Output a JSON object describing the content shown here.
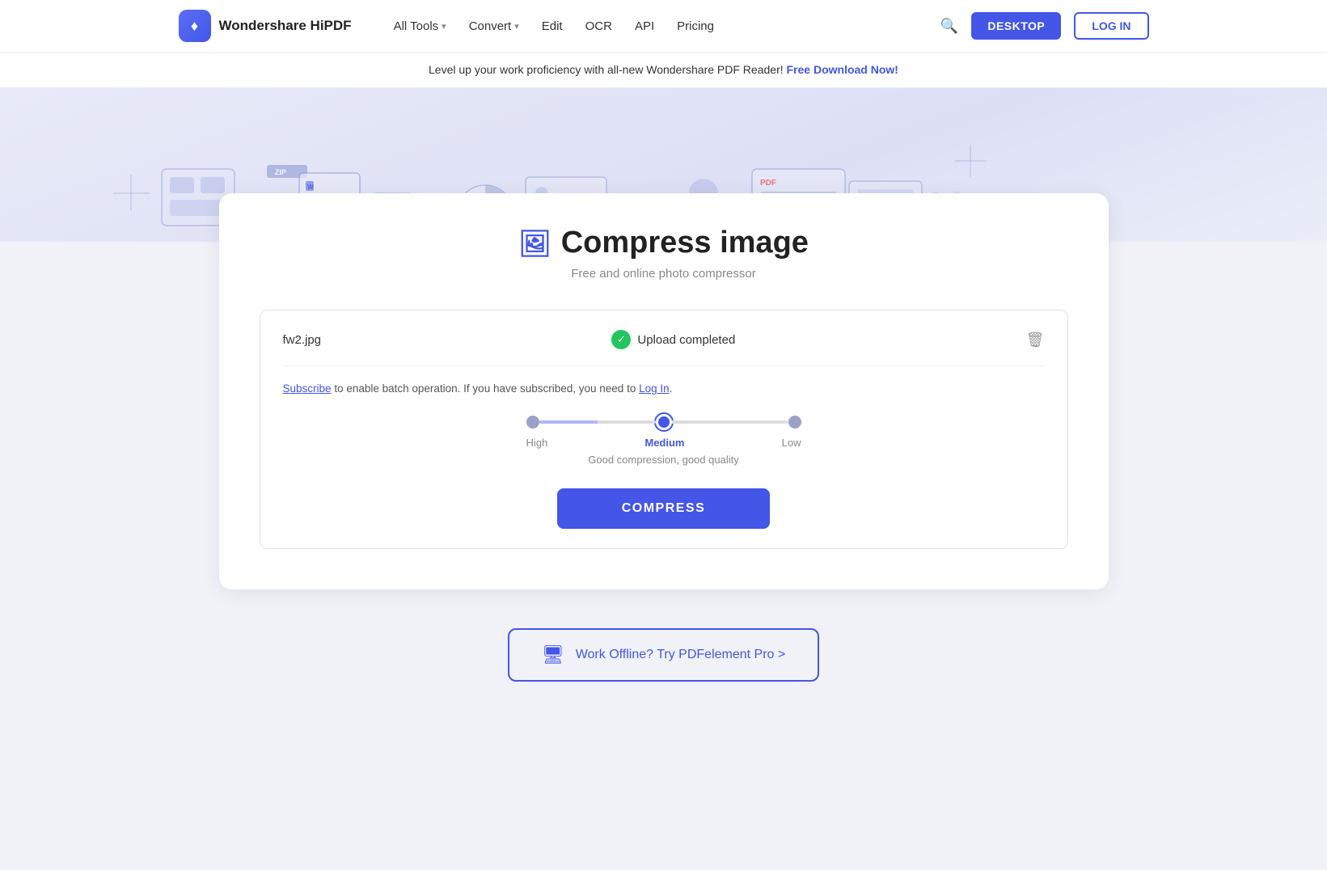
{
  "brand": {
    "name": "Wondershare HiPDF",
    "logo_char": "♦"
  },
  "nav": {
    "links": [
      {
        "id": "all-tools",
        "label": "All Tools",
        "has_dropdown": true
      },
      {
        "id": "convert",
        "label": "Convert",
        "has_dropdown": true
      },
      {
        "id": "edit",
        "label": "Edit",
        "has_dropdown": false
      },
      {
        "id": "ocr",
        "label": "OCR",
        "has_dropdown": false
      },
      {
        "id": "api",
        "label": "API",
        "has_dropdown": false
      },
      {
        "id": "pricing",
        "label": "Pricing",
        "has_dropdown": false
      }
    ],
    "desktop_btn": "DESKTOP",
    "login_btn": "LOG IN"
  },
  "banner": {
    "text": "Level up your work proficiency with all-new Wondershare PDF Reader!",
    "link_text": "Free Download Now!"
  },
  "page": {
    "title": "Compress image",
    "subtitle": "Free and online photo compressor",
    "title_icon": "🖼"
  },
  "upload": {
    "file_name": "fw2.jpg",
    "status": "Upload completed"
  },
  "subscribe_note": {
    "prefix": "",
    "subscribe_link": "Subscribe",
    "middle": " to enable batch operation. If you have subscribed, you need to",
    "login_link": "Log In",
    "suffix": "."
  },
  "compression": {
    "levels": [
      {
        "id": "high",
        "label": "High",
        "active": false
      },
      {
        "id": "medium",
        "label": "Medium",
        "active": true
      },
      {
        "id": "low",
        "label": "Low",
        "active": false
      }
    ],
    "description": "Good compression, good quality",
    "compress_btn": "COMPRESS"
  },
  "offline_promo": {
    "text": "Work Offline? Try PDFelement Pro >"
  }
}
